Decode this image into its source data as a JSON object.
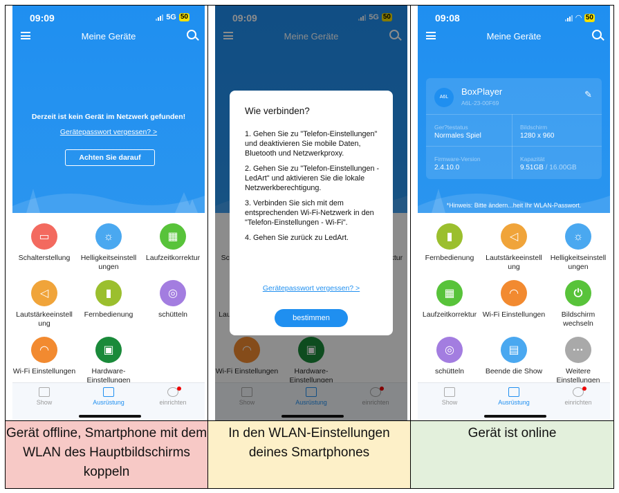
{
  "panel1": {
    "time": "09:09",
    "network": "5G",
    "battery": "50",
    "title": "Meine Geräte",
    "no_device": "Derzeit ist kein Gerät im Netzwerk gefunden!",
    "forgot_password": "Gerätepasswort vergessen? >",
    "notice_button": "Achten Sie darauf",
    "features": [
      {
        "label": "Schalterstellung",
        "color": "#f36a5f",
        "icon": "switch-icon"
      },
      {
        "label": "Helligkeitseinstell ungen",
        "color": "#4aa8f0",
        "icon": "brightness-icon"
      },
      {
        "label": "Laufzeitkorrektur",
        "color": "#58c33a",
        "icon": "calendar-icon"
      },
      {
        "label": "Lautstärkeeinstell ung",
        "color": "#f0a43a",
        "icon": "volume-icon"
      },
      {
        "label": "Fernbedienung",
        "color": "#9bbf2e",
        "icon": "remote-icon"
      },
      {
        "label": "schütteln",
        "color": "#a37de0",
        "icon": "shake-icon"
      },
      {
        "label": "Wi-Fi Einstellungen",
        "color": "#f28a30",
        "icon": "wifi-icon"
      },
      {
        "label": "Hardware-Einstellungen",
        "color": "#1a8a3a",
        "icon": "chip-icon"
      }
    ],
    "caption": "Gerät offline, Smartphone mit dem WLAN des Hauptbildschirms koppeln"
  },
  "panel2": {
    "time": "09:09",
    "network": "5G",
    "battery": "50",
    "title": "Meine Geräte",
    "dialog_title": "Wie verbinden?",
    "steps": [
      "1. Gehen Sie zu \"Telefon-Einstellungen\" und deaktivieren Sie mobile Daten, Bluetooth und Netzwerkproxy.",
      "2. Gehen Sie zu \"Telefon-Einstellungen - LedArt\" und aktivieren Sie die lokale Netzwerkberechtigung.",
      "3. Verbinden Sie sich mit dem entsprechenden Wi-Fi-Netzwerk in den \"Telefon-Einstellungen - Wi-Fi\".",
      "4. Gehen Sie zurück zu LedArt."
    ],
    "forgot_password": "Gerätepasswort vergessen? >",
    "confirm": "bestimmen",
    "caption": "In den WLAN-Einstellungen deines Smartphones"
  },
  "panel3": {
    "time": "09:08",
    "battery": "50",
    "title": "Meine Geräte",
    "device_badge": "A6L",
    "device_name": "BoxPlayer",
    "device_id": "A6L-23-00F69",
    "status_label": "Ger?testatus",
    "status_value": "Normales Spiel",
    "screen_label": "Bildschirm",
    "screen_value": "1280 x 960",
    "firmware_label": "Firmware-Version",
    "firmware_value": "2.4.10.0",
    "capacity_label": "Kapazität",
    "capacity_used": "9.51GB",
    "capacity_total": " / 16.00GB",
    "hint": "*Hinweis: Bitte ändern...heit Ihr WLAN-Passwort.",
    "features": [
      {
        "label": "Fernbedienung",
        "color": "#9bbf2e",
        "icon": "remote-icon"
      },
      {
        "label": "Lautstärkeeinstell ung",
        "color": "#f0a43a",
        "icon": "volume-icon"
      },
      {
        "label": "Helligkeitseinstell ungen",
        "color": "#4aa8f0",
        "icon": "brightness-icon"
      },
      {
        "label": "Laufzeitkorrektur",
        "color": "#58c33a",
        "icon": "calendar-icon"
      },
      {
        "label": "Wi-Fi Einstellungen",
        "color": "#f28a30",
        "icon": "wifi-icon"
      },
      {
        "label": "Bildschirm wechseln",
        "color": "#58c33a",
        "icon": "power-icon"
      },
      {
        "label": "schütteln",
        "color": "#a37de0",
        "icon": "shake-icon"
      },
      {
        "label": "Beende die Show",
        "color": "#4aa8f0",
        "icon": "stop-show-icon"
      },
      {
        "label": "Weitere Einstellungen",
        "color": "#a9a9a9",
        "icon": "more-icon"
      }
    ],
    "caption": "Gerät ist online"
  },
  "tabs": [
    "Show",
    "Ausrüstung",
    "einrichten"
  ]
}
